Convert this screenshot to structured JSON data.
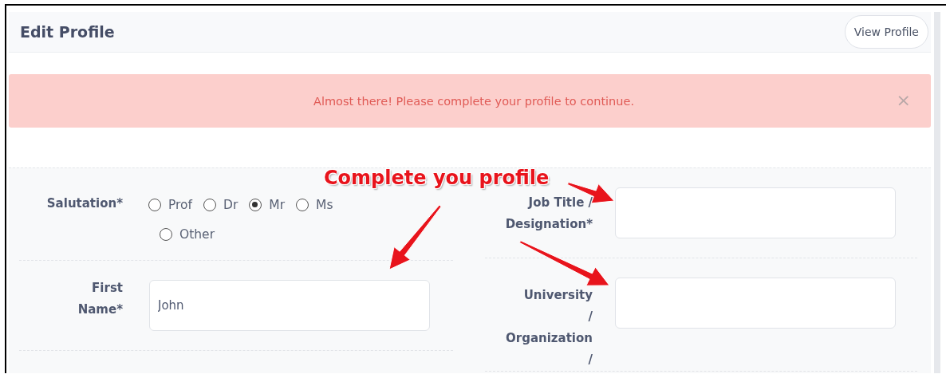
{
  "header": {
    "title": "Edit Profile",
    "button": "View Profile"
  },
  "alert": {
    "message": "Almost there! Please complete your profile to continue.",
    "close": "×"
  },
  "form": {
    "left": [
      {
        "kind": "radio",
        "label": "Salutation*",
        "options": [
          {
            "label": "Prof",
            "selected": false
          },
          {
            "label": "Dr",
            "selected": false
          },
          {
            "label": "Mr",
            "selected": true
          },
          {
            "label": "Ms",
            "selected": false
          },
          {
            "label": "Other",
            "selected": false
          }
        ]
      },
      {
        "kind": "text",
        "label": "First\nName*",
        "value": "John"
      }
    ],
    "right": [
      {
        "kind": "text",
        "label": "Job Title /\nDesignation*"
      },
      {
        "kind": "text",
        "label": "University\n/\nOrganization\n/"
      }
    ]
  },
  "annotation": {
    "text": "Complete you profile"
  }
}
